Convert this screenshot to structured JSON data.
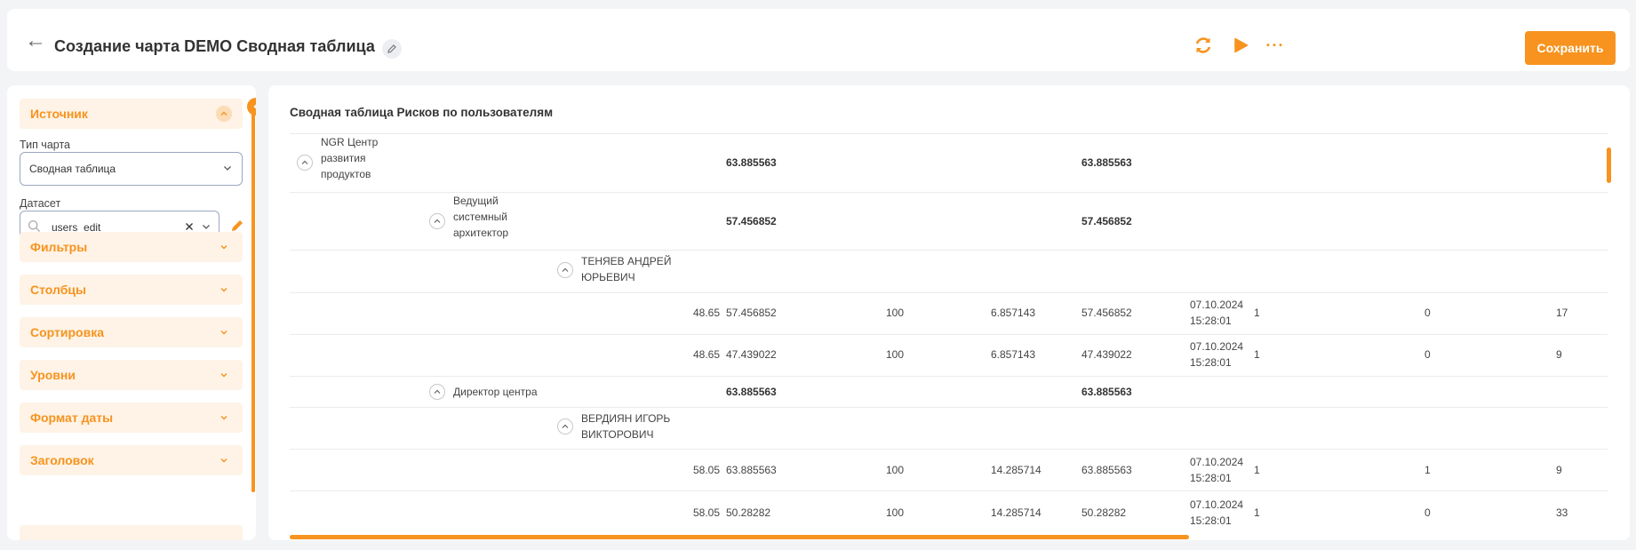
{
  "header": {
    "title": "Создание чарта DEMO Сводная таблица",
    "save_label": "Сохранить",
    "more_label": "···"
  },
  "sidebar": {
    "source": "Источник",
    "chart_type_label": "Тип чарта",
    "chart_type_value": "Сводная таблица",
    "dataset_label": "Датасет",
    "dataset_value": "users_edit",
    "sections": [
      "Фильтры",
      "Столбцы",
      "Сортировка",
      "Уровни",
      "Формат даты",
      "Заголовок"
    ]
  },
  "main": {
    "title": "Сводная таблица Рисков по пользователям",
    "rows": [
      {
        "group": "NGR Центр\nразвития\nпродуктов",
        "bold_a": "63.885563",
        "bold_b": "63.885563"
      },
      {
        "group": "Ведущий\nсистемный\nархитектор",
        "bold_a": "57.456852",
        "bold_b": "57.456852"
      },
      {
        "group": "ТЕНЯЕВ АНДРЕЙ\nЮРЬЕВИЧ"
      },
      {
        "c1": "48.65",
        "c2": "57.456852",
        "c3": "100",
        "c4": "6.857143",
        "c5": "57.456852",
        "c6": "07.10.2024\n15:28:01",
        "c7": "1",
        "c8": "0",
        "c9": "17"
      },
      {
        "c1": "48.65",
        "c2": "47.439022",
        "c3": "100",
        "c4": "6.857143",
        "c5": "47.439022",
        "c6": "07.10.2024\n15:28:01",
        "c7": "1",
        "c8": "0",
        "c9": "9"
      },
      {
        "group": "Директор центра",
        "bold_a": "63.885563",
        "bold_b": "63.885563"
      },
      {
        "group": "ВЕРДИЯН ИГОРЬ\nВИКТОРОВИЧ"
      },
      {
        "c1": "58.05",
        "c2": "63.885563",
        "c3": "100",
        "c4": "14.285714",
        "c5": "63.885563",
        "c6": "07.10.2024\n15:28:01",
        "c7": "1",
        "c8": "1",
        "c9": "9"
      },
      {
        "c1": "58.05",
        "c2": "50.28282",
        "c3": "100",
        "c4": "14.285714",
        "c5": "50.28282",
        "c6": "07.10.2024\n15:28:01",
        "c7": "1",
        "c8": "0",
        "c9": "33"
      }
    ]
  },
  "colors": {
    "accent": "#f7931e",
    "accent_light": "#fef3e6"
  }
}
